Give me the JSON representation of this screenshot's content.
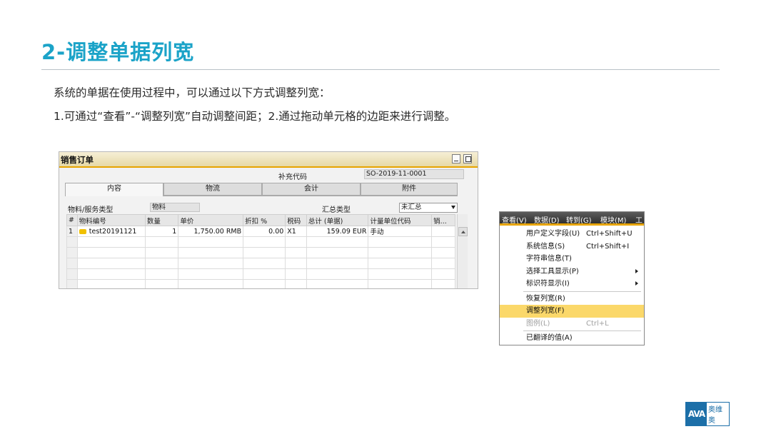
{
  "slide": {
    "title": "2-调整单据列宽",
    "line1": "系统的单据在使用过程中，可以通过以下方式调整列宽：",
    "line2": "1.可通过“查看”-“调整列宽”自动调整间距；2.通过拖动单元格的边距来进行调整。"
  },
  "sales_order": {
    "title": "销售订单",
    "supplementary_code_label": "补充代码",
    "supplementary_code_value": "SO-2019-11-0001",
    "tabs": [
      "内容",
      "物流",
      "会计",
      "附件"
    ],
    "item_type_label": "物料/服务类型",
    "item_type_value": "物料",
    "summary_type_label": "汇总类型",
    "summary_type_value": "未汇总",
    "columns": [
      "#",
      "物料编号",
      "数量",
      "单价",
      "折扣 %",
      "税码",
      "总计 (单据)",
      "计量单位代码",
      "销..."
    ],
    "row1": {
      "index": "1",
      "item_code": "test20191121",
      "quantity": "1",
      "unit_price": "1,750.00 RMB",
      "discount": "0.00",
      "tax_code": "X1",
      "total": "159.09 EUR",
      "uom_code": "手动"
    }
  },
  "view_menu": {
    "menubar": [
      "查看(V)",
      "数据(D)",
      "转到(G)",
      "模块(M)",
      "工"
    ],
    "items": [
      {
        "label": "用户定义字段(U)",
        "shortcut": "Ctrl+Shift+U"
      },
      {
        "label": "系统信息(S)",
        "shortcut": "Ctrl+Shift+I"
      },
      {
        "label": "字符串信息(T)",
        "shortcut": ""
      },
      {
        "label": "选择工具显示(P)",
        "shortcut": ""
      },
      {
        "label": "标识符显示(I)",
        "shortcut": ""
      },
      {
        "label": "恢复列宽(R)",
        "shortcut": ""
      },
      {
        "label": "调整列宽(F)",
        "shortcut": ""
      },
      {
        "label": "图例(L)",
        "shortcut": "Ctrl+L"
      },
      {
        "label": "已翻译的值(A)",
        "shortcut": ""
      }
    ]
  },
  "logo": {
    "mark": "AVA",
    "text": "奥维奥"
  }
}
